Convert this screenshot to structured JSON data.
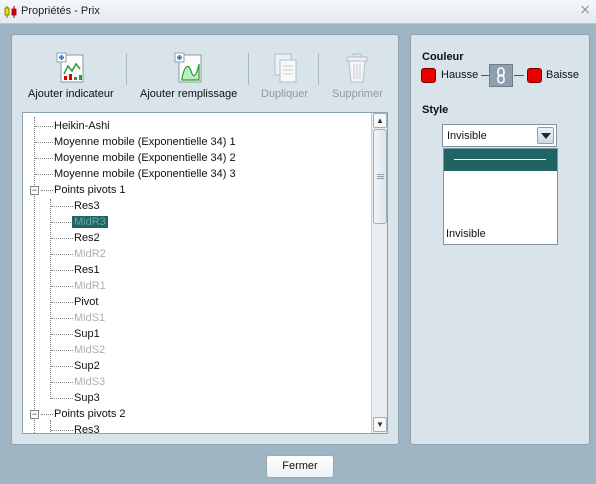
{
  "window": {
    "title": "Propriétés - Prix",
    "close_glyph": "×"
  },
  "toolbar": {
    "add_indicator": "Ajouter indicateur",
    "add_fill": "Ajouter remplissage",
    "duplicate": "Dupliquer",
    "delete": "Supprimer"
  },
  "tree": {
    "items": [
      {
        "label": "Heikin-Ashi",
        "muted": false,
        "selected": false
      },
      {
        "label": "Moyenne mobile (Exponentielle 34) 1",
        "muted": false,
        "selected": false
      },
      {
        "label": "Moyenne mobile (Exponentielle 34) 2",
        "muted": false,
        "selected": false
      },
      {
        "label": "Moyenne mobile (Exponentielle 34) 3",
        "muted": false,
        "selected": false
      },
      {
        "label": "Points pivots 1",
        "muted": false,
        "selected": false
      },
      {
        "label": "Res3",
        "muted": false,
        "selected": false
      },
      {
        "label": "MidR3",
        "muted": true,
        "selected": true
      },
      {
        "label": "Res2",
        "muted": false,
        "selected": false
      },
      {
        "label": "MidR2",
        "muted": true,
        "selected": false
      },
      {
        "label": "Res1",
        "muted": false,
        "selected": false
      },
      {
        "label": "MidR1",
        "muted": true,
        "selected": false
      },
      {
        "label": "Pivot",
        "muted": false,
        "selected": false
      },
      {
        "label": "MidS1",
        "muted": true,
        "selected": false
      },
      {
        "label": "Sup1",
        "muted": false,
        "selected": false
      },
      {
        "label": "MidS2",
        "muted": true,
        "selected": false
      },
      {
        "label": "Sup2",
        "muted": false,
        "selected": false
      },
      {
        "label": "MidS3",
        "muted": true,
        "selected": false
      },
      {
        "label": "Sup3",
        "muted": false,
        "selected": false
      },
      {
        "label": "Points pivots 2",
        "muted": false,
        "selected": false
      },
      {
        "label": "Res3",
        "muted": false,
        "selected": false
      }
    ]
  },
  "color_section": {
    "title": "Couleur",
    "up_label": "Hausse",
    "down_label": "Baisse",
    "up_color": "#e80000",
    "down_color": "#e80000"
  },
  "style_section": {
    "title": "Style",
    "current": "Invisible",
    "options": [
      {
        "kind": "solid",
        "label": ""
      },
      {
        "kind": "long-dash",
        "label": ""
      },
      {
        "kind": "dash",
        "label": ""
      },
      {
        "kind": "dotted",
        "label": ""
      },
      {
        "kind": "none",
        "label": "Invisible"
      }
    ]
  },
  "buttons": {
    "close": "Fermer"
  },
  "colors": {
    "accent": "#1f6462",
    "panel": "#d9e3ea",
    "window_bg": "#9fb5c4"
  }
}
